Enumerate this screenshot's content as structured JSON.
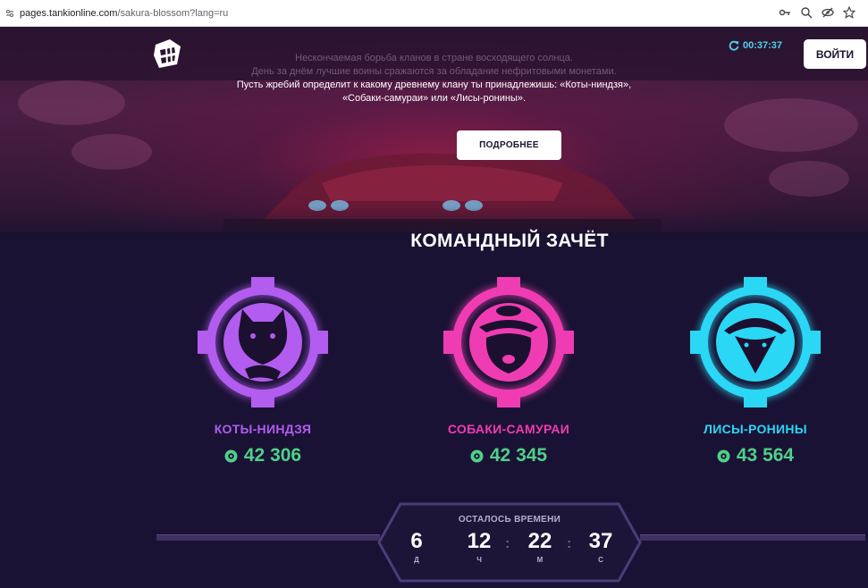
{
  "browser": {
    "url_host": "pages.tankionline.com",
    "url_path": "/sakura-blossom?lang=ru"
  },
  "header": {
    "timer": "00:37:37",
    "login_label": "ВОЙТИ"
  },
  "hero": {
    "line1": "Нескончаемая борьба кланов в стране восходящего солнца.",
    "line2": "День за днём лучшие воины сражаются за обладание нефритовыми монетами.",
    "line3": "Пусть жребий определит к какому древнему клану ты принадлежишь: «Коты-ниндзя»,",
    "line4": "«Собаки-самураи» или «Лисы-ронины».",
    "more_label": "ПОДРОБНЕЕ"
  },
  "scoreboard": {
    "title": "КОМАНДНЫЙ ЗАЧЁТ",
    "teams": [
      {
        "name": "КОТЫ-НИНДЗЯ",
        "score": "42 306",
        "color": "#b25cf0",
        "icon": "cat-ninja-emblem-icon"
      },
      {
        "name": "СОБАКИ-САМУРАИ",
        "score": "42 345",
        "color": "#f03cb2",
        "icon": "dog-samurai-emblem-icon"
      },
      {
        "name": "ЛИСЫ-РОНИНЫ",
        "score": "43 564",
        "color": "#2ad7f5",
        "icon": "fox-ronin-emblem-icon"
      }
    ]
  },
  "countdown": {
    "label": "ОСТАЛОСЬ ВРЕМЕНИ",
    "days": "6",
    "days_label": "Д",
    "hours": "12",
    "hours_label": "Ч",
    "minutes": "22",
    "minutes_label": "М",
    "seconds": "37",
    "seconds_label": "С",
    "separator": ":"
  },
  "colors": {
    "score_green": "#4fd08a",
    "timer_cyan": "#4dd3f0"
  }
}
